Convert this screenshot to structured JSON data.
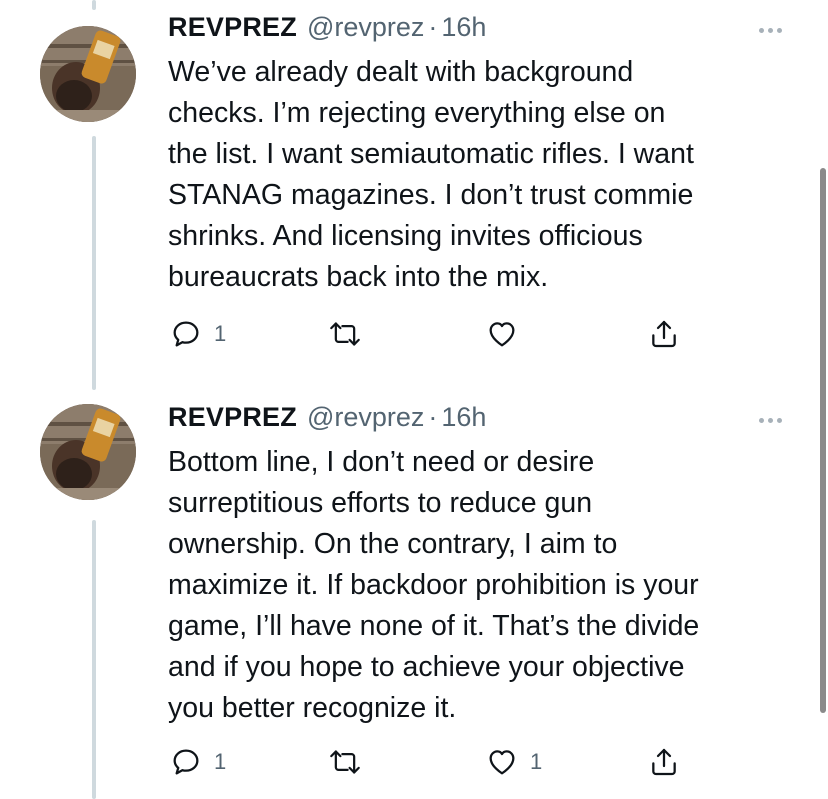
{
  "tweets": [
    {
      "name": "REVPREZ",
      "handle": "@revprez",
      "separator": "·",
      "time": "16h",
      "lines": [
        "We’ve already dealt with background",
        "checks. I’m rejecting everything else on",
        "the list. I want semiautomatic rifles. I want",
        "STANAG magazines. I don’t trust commie",
        "shrinks. And licensing invites officious",
        "bureaucrats back into the mix."
      ],
      "reply_count": "1",
      "retweet_count": "",
      "like_count": ""
    },
    {
      "name": "REVPREZ",
      "handle": "@revprez",
      "separator": "·",
      "time": "16h",
      "lines": [
        "Bottom line, I don’t need or desire",
        "surreptitious efforts to reduce gun",
        "ownership. On the contrary, I aim to",
        "maximize it. If backdoor prohibition is your",
        "game, I’ll have none of it. That’s the divide",
        "and if you hope to achieve your objective",
        "you better recognize it."
      ],
      "reply_count": "1",
      "retweet_count": "",
      "like_count": "1"
    }
  ],
  "icons": {
    "reply": "reply-icon",
    "retweet": "retweet-icon",
    "like": "heart-icon",
    "share": "share-icon",
    "more": "more-icon"
  },
  "colors": {
    "text": "#0f1419",
    "secondary": "#536471",
    "thread_line": "#cfd9de"
  }
}
